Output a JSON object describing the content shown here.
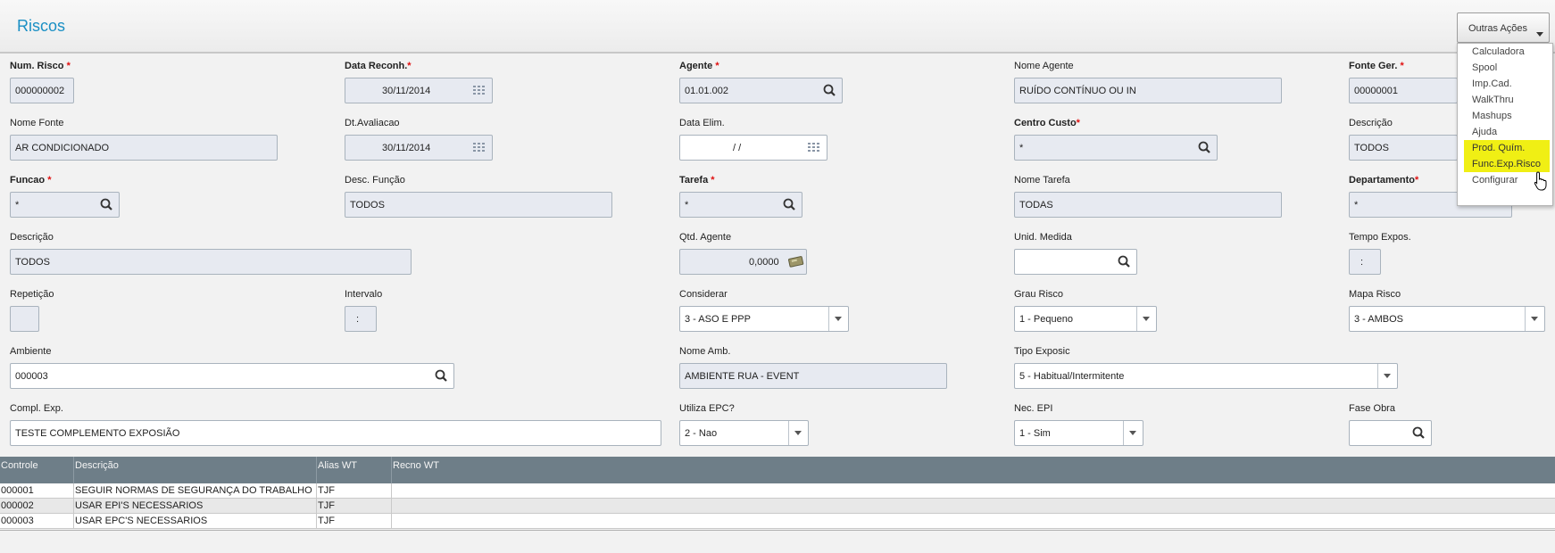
{
  "title": "Riscos",
  "actions": {
    "button_label": "Outras Ações",
    "menu": [
      "Calculadora",
      "Spool",
      "Imp.Cad.",
      "WalkThru",
      "Mashups",
      "Ajuda",
      "Prod. Quím.",
      "Func.Exp.Risco",
      "Configurar"
    ],
    "highlight_color": "#f0ef14"
  },
  "form": {
    "num_risco": {
      "label": "Num. Risco",
      "value": "000000002"
    },
    "data_reconh": {
      "label": "Data Reconh.",
      "value": "30/11/2014"
    },
    "agente": {
      "label": "Agente",
      "value": "01.01.002"
    },
    "nome_agente": {
      "label": "Nome Agente",
      "value": "RUÍDO CONTÍNUO OU IN"
    },
    "fonte_ger": {
      "label": "Fonte Ger.",
      "value": "00000001"
    },
    "nome_fonte": {
      "label": "Nome Fonte",
      "value": "AR CONDICIONADO"
    },
    "dt_avaliacao": {
      "label": "Dt.Avaliacao",
      "value": "30/11/2014"
    },
    "data_elim": {
      "label": "Data Elim.",
      "value": "/ /"
    },
    "centro_custo": {
      "label": "Centro Custo",
      "value": "*"
    },
    "descricao_cc": {
      "label": "Descrição",
      "value": "TODOS"
    },
    "funcao": {
      "label": "Funcao",
      "value": "*"
    },
    "desc_funcao": {
      "label": "Desc. Função",
      "value": "TODOS"
    },
    "tarefa": {
      "label": "Tarefa",
      "value": "*"
    },
    "nome_tarefa": {
      "label": "Nome Tarefa",
      "value": "TODAS"
    },
    "departamento": {
      "label": "Departamento",
      "value": "*"
    },
    "descricao": {
      "label": "Descrição",
      "value": "TODOS"
    },
    "qtd_agente": {
      "label": "Qtd. Agente",
      "value": "0,0000"
    },
    "unid_medida": {
      "label": "Unid. Medida",
      "value": ""
    },
    "tempo_expos": {
      "label": "Tempo Expos.",
      "value": ":"
    },
    "repeticao": {
      "label": "Repetição",
      "value": ""
    },
    "intervalo": {
      "label": "Intervalo",
      "value": ":"
    },
    "considerar": {
      "label": "Considerar",
      "value": "3 - ASO E PPP"
    },
    "grau_risco": {
      "label": "Grau Risco",
      "value": "1 - Pequeno"
    },
    "mapa_risco": {
      "label": "Mapa Risco",
      "value": "3 - AMBOS"
    },
    "ambiente": {
      "label": "Ambiente",
      "value": "000003"
    },
    "nome_amb": {
      "label": "Nome Amb.",
      "value": "AMBIENTE RUA - EVENT"
    },
    "tipo_exposic": {
      "label": "Tipo Exposic",
      "value": "5 - Habitual/Intermitente"
    },
    "compl_exp": {
      "label": "Compl. Exp.",
      "value": "TESTE COMPLEMENTO EXPOSIÃO"
    },
    "utiliza_epc": {
      "label": "Utiliza EPC?",
      "value": "2 - Nao"
    },
    "nec_epi": {
      "label": "Nec. EPI",
      "value": "1 - Sim"
    },
    "fase_obra": {
      "label": "Fase Obra",
      "value": ""
    }
  },
  "grid": {
    "columns": [
      "Controle",
      "Descrição",
      "Alias WT",
      "Recno WT"
    ],
    "rows": [
      [
        "000001",
        "SEGUIR NORMAS DE SEGURANÇA DO TRABALHO",
        "TJF",
        ""
      ],
      [
        "000002",
        "USAR EPI'S NECESSARIOS",
        "TJF",
        ""
      ],
      [
        "000003",
        "USAR EPC'S NECESSARIOS",
        "TJF",
        ""
      ]
    ]
  },
  "colors": {
    "title": "#1a8fc4",
    "required_star": "#e01010",
    "grid_header": "#6e7e88"
  }
}
